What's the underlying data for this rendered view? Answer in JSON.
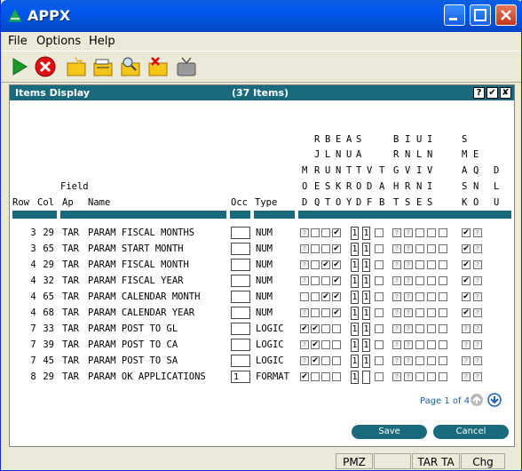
{
  "window": {
    "title": "APPX"
  },
  "menu": [
    "File",
    "Options",
    "Help"
  ],
  "toolbar": {
    "icons": [
      "run-icon",
      "cancel-icon",
      "new-icon",
      "edit-icon",
      "search-icon",
      "delete-icon",
      "tv-icon"
    ]
  },
  "panel": {
    "title": "Items Display",
    "count": "(37 Items)",
    "help": "?",
    "ok": "✔",
    "close": "✘"
  },
  "headers": {
    "line1": "R B E A S",
    "row1": "RBEAS",
    "col_row": "Row",
    "col_col": "Col",
    "col_field": "Field",
    "col_ap": "Ap",
    "col_name": "Name",
    "col_occ": "Occ",
    "col_type": "Type",
    "flag_h1": "  RBEAS    BIUI  S  ",
    "flag_h2": "  JLNUA    RNLN  M  ",
    "flag_h3": "MRUNTTV  TGVIV  AQD",
    "flag_h4": "OESKRODD AHRNI  SNL",
    "flag_h5": "DQTOYDF  BTSES  KOU"
  },
  "flag_headers": [
    "    R B E A S       B I U I       S    ",
    "    J L N U A       R N L N       M E  ",
    "  M R U N T T V   T G V I V       A Q D",
    "  O E S K R O D   A H R N I       S N L",
    "  D Q T O Y D F   B T S E S       K O U"
  ],
  "rows": [
    {
      "row": "3",
      "col": "29",
      "ap": "TAR",
      "name": "PARAM FISCAL MONTHS",
      "occ": "",
      "type": "NUM",
      "flags": "q__c|11_|qq___|cq"
    },
    {
      "row": "3",
      "col": "65",
      "ap": "TAR",
      "name": "PARAM START MONTH",
      "occ": "",
      "type": "NUM",
      "flags": "q__c|11_|qq___|cq"
    },
    {
      "row": "4",
      "col": "29",
      "ap": "TAR",
      "name": "PARAM FISCAL MONTH",
      "occ": "",
      "type": "NUM",
      "flags": "q_cc|11_|qq___|cq"
    },
    {
      "row": "4",
      "col": "32",
      "ap": "TAR",
      "name": "PARAM FISCAL YEAR",
      "occ": "",
      "type": "NUM",
      "flags": "q__c|11_|qq___|cq"
    },
    {
      "row": "4",
      "col": "65",
      "ap": "TAR",
      "name": "PARAM CALENDAR MONTH",
      "occ": "",
      "type": "NUM",
      "flags": "__cc|11_|qq___|cq"
    },
    {
      "row": "4",
      "col": "68",
      "ap": "TAR",
      "name": "PARAM CALENDAR YEAR",
      "occ": "",
      "type": "NUM",
      "flags": "q__c|11_|qq___|cq"
    },
    {
      "row": "7",
      "col": "33",
      "ap": "TAR",
      "name": "PARAM POST TO GL",
      "occ": "",
      "type": "LOGIC",
      "flags": "cc__|11_|qq___|qq"
    },
    {
      "row": "7",
      "col": "39",
      "ap": "TAR",
      "name": "PARAM POST TO CA",
      "occ": "",
      "type": "LOGIC",
      "flags": "qc__|11_|qq___|qq"
    },
    {
      "row": "7",
      "col": "45",
      "ap": "TAR",
      "name": "PARAM POST TO SA",
      "occ": "",
      "type": "LOGIC",
      "flags": "qc__|11_|qq___|qq"
    },
    {
      "row": "8",
      "col": "29",
      "ap": "TAR",
      "name": "PARAM OK APPLICATIONS",
      "occ": "1",
      "type": "FORMAT",
      "flags": "c___|1__|qq___|qq"
    }
  ],
  "pager": {
    "text": "Page 1 of 4"
  },
  "buttons": {
    "save": "Save",
    "cancel": "Cancel"
  },
  "status": [
    "PMZ",
    "TAR TA",
    "Chg"
  ]
}
